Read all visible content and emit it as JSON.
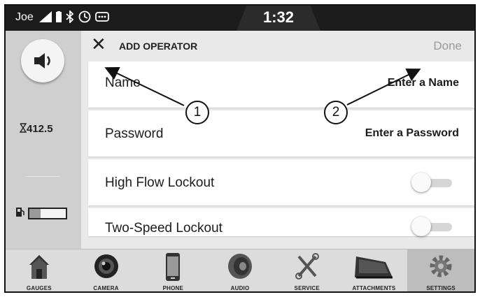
{
  "status": {
    "user": "Joe",
    "time": "1:32",
    "icons": [
      "signal-icon",
      "battery-icon",
      "bluetooth-icon",
      "clock-icon",
      "message-icon"
    ]
  },
  "rail": {
    "volume_icon": "speaker-icon",
    "hours_icon": "hourglass-icon",
    "hours_value": "412.5",
    "fuel_icon": "fuel-pump-icon",
    "fuel_level": 0.3
  },
  "header": {
    "close_icon": "close-icon",
    "title": "ADD OPERATOR",
    "done_label": "Done"
  },
  "form": {
    "rows": [
      {
        "label": "Name",
        "value": "Enter a Name"
      },
      {
        "label": "Password",
        "value": "Enter a Password"
      },
      {
        "label": "High Flow Lockout",
        "toggle": false
      },
      {
        "label": "Two-Speed Lockout",
        "toggle": false
      }
    ]
  },
  "nav": {
    "items": [
      {
        "label": "GAUGES",
        "icon": "house-icon"
      },
      {
        "label": "CAMERA",
        "icon": "camera-lens-icon"
      },
      {
        "label": "PHONE",
        "icon": "phone-icon"
      },
      {
        "label": "AUDIO",
        "icon": "speaker-icon"
      },
      {
        "label": "SERVICE",
        "icon": "wrench-icon"
      },
      {
        "label": "ATTACHMENTS",
        "icon": "bucket-icon"
      },
      {
        "label": "SETTINGS",
        "icon": "gear-icon"
      }
    ],
    "active": "SETTINGS"
  },
  "callouts": [
    "1",
    "2"
  ],
  "colors": {
    "statusbar": "#1c1c1c",
    "rail": "#cfcfcf",
    "background": "#e9e9e9",
    "row": "#ffffff",
    "done_disabled": "#9a9a9a"
  }
}
